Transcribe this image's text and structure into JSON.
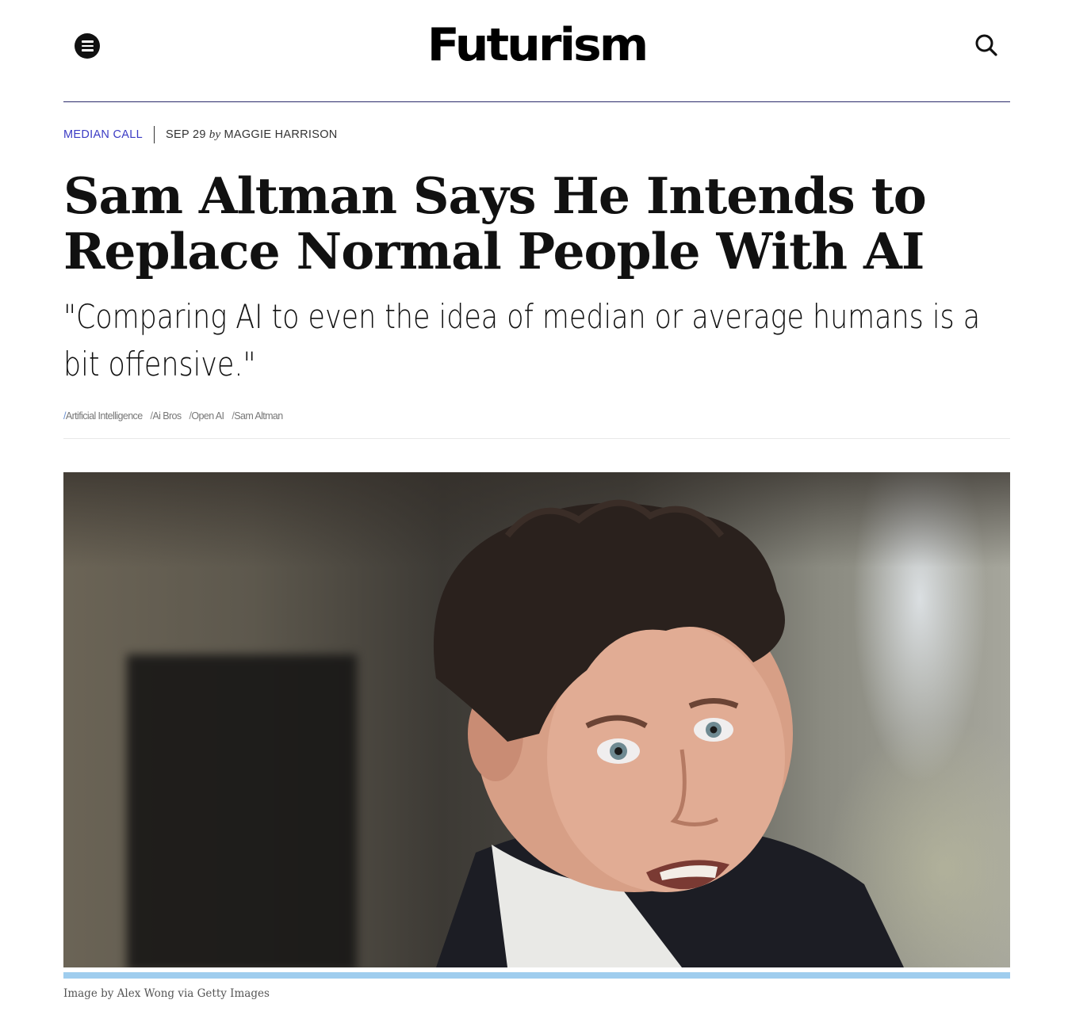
{
  "header": {
    "logo_text": "Futurism",
    "menu_icon": "hamburger-menu-icon",
    "search_icon": "search-icon"
  },
  "article": {
    "category": "MEDIAN CALL",
    "date": "SEP 29",
    "by": "by",
    "author": "MAGGIE HARRISON",
    "title": "Sam Altman Says He Intends to Replace Normal People With AI",
    "dek": "\"Comparing AI to even the idea of median or average humans is a bit offensive.\"",
    "tags": [
      {
        "slash": "/",
        "label": "Artificial Intelligence"
      },
      {
        "slash": "/",
        "label": "Ai Bros"
      },
      {
        "slash": "/",
        "label": "Open AI"
      },
      {
        "slash": "/",
        "label": "Sam Altman"
      }
    ],
    "image_caption": "Image by Alex Wong via Getty Images"
  },
  "colors": {
    "accent": "#3b3bc4",
    "rule": "#2b2a6b",
    "progress": "#9fcdee"
  }
}
